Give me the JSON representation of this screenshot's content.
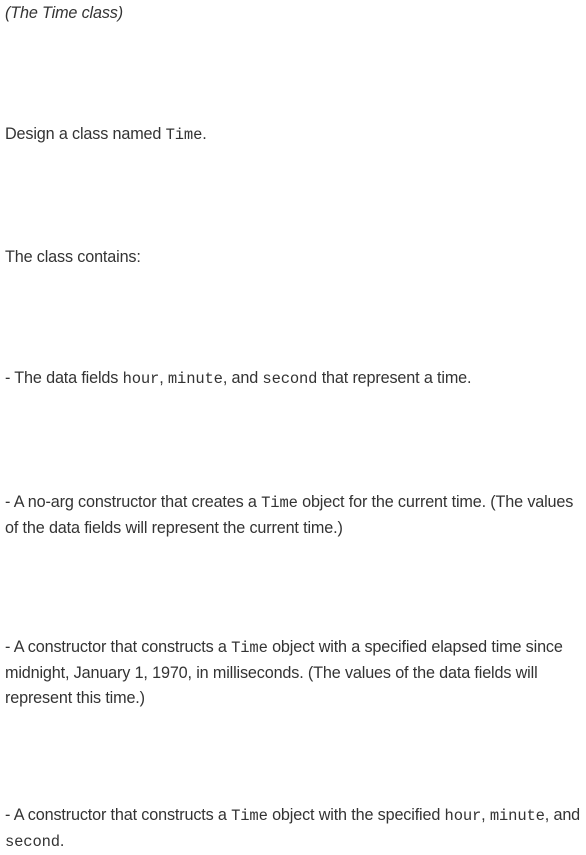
{
  "title": "(The Time class)",
  "p1": {
    "pre": "Design a class named ",
    "code1": "Time",
    "post": "."
  },
  "p2": {
    "text": "The class contains:"
  },
  "p3": {
    "pre": "- The data fields ",
    "code1": "hour",
    "sep1": ", ",
    "code2": "minute",
    "sep2": ", and ",
    "code3": "second",
    "post": " that represent a time."
  },
  "p4": {
    "pre": "- A no-arg constructor that creates a ",
    "code1": "Time",
    "post": " object for the current time. (The values of the data fields will represent the current time.)"
  },
  "p5": {
    "pre": "- A constructor that constructs a ",
    "code1": "Time",
    "post": " object with a specified elapsed time since midnight, January 1, 1970, in milliseconds. (The values of the data fields will represent this time.)"
  },
  "p6": {
    "pre": "- A constructor that constructs a ",
    "code1": "Time",
    "mid": " object with the specified ",
    "code2": "hour",
    "sep1": ", ",
    "code3": "minute",
    "sep2": ", and ",
    "code4": "second",
    "post": "."
  }
}
